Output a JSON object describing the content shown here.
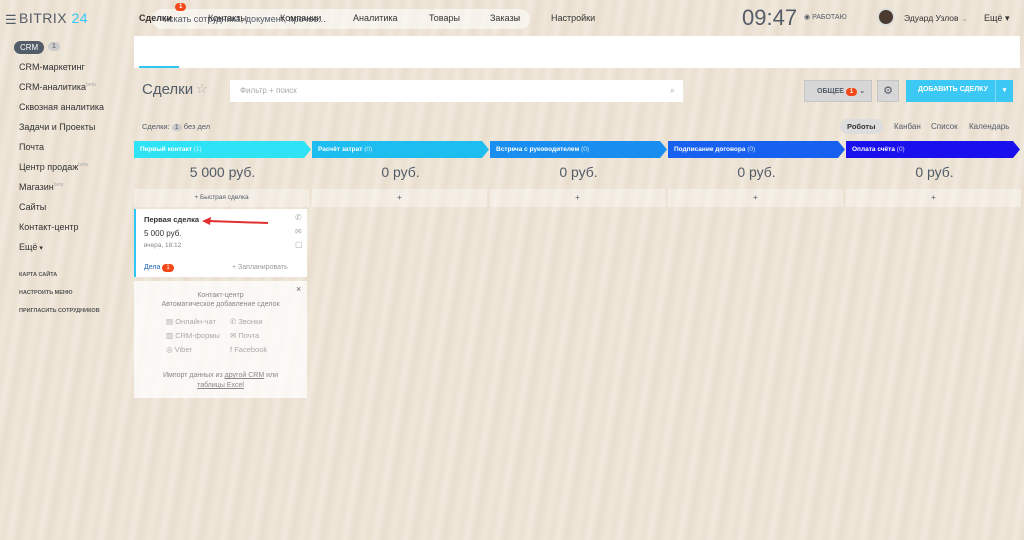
{
  "app": {
    "logo_text": "BITRIX",
    "logo_num": "24",
    "menu_icon": "☰"
  },
  "search": {
    "placeholder": "искать сотрудника, документ, прочее..."
  },
  "clock": {
    "time": "09:47",
    "status": "РАБОТАЮ"
  },
  "user": {
    "name": "Эдуард Узлов"
  },
  "sidebar": {
    "crm": "CRM",
    "crm_count": "1",
    "items": [
      {
        "label": "CRM-маркетинг",
        "sup": ""
      },
      {
        "label": "CRM-аналитика",
        "sup": "beta"
      },
      {
        "label": "Сквозная аналитика",
        "sup": ""
      },
      {
        "label": "Задачи и Проекты",
        "sup": ""
      },
      {
        "label": "Почта",
        "sup": ""
      },
      {
        "label": "Центр продаж",
        "sup": "beta"
      },
      {
        "label": "Магазин",
        "sup": "beta"
      },
      {
        "label": "Сайты",
        "sup": ""
      },
      {
        "label": "Контакт-центр",
        "sup": ""
      },
      {
        "label": "Ещё",
        "sup": ""
      }
    ],
    "small": [
      "КАРТА САЙТА",
      "НАСТРОИТЬ МЕНЮ",
      "ПРИГЛАСИТЬ СОТРУДНИКОВ"
    ]
  },
  "tabs": [
    {
      "label": "Сделки",
      "badge": "1"
    },
    {
      "label": "Контакты"
    },
    {
      "label": "Компании"
    },
    {
      "label": "Аналитика"
    },
    {
      "label": "Товары"
    },
    {
      "label": "Заказы"
    },
    {
      "label": "Настройки"
    }
  ],
  "tabs_more": "Ещё",
  "page": {
    "title": "Сделки",
    "filter_placeholder": "Фильтр + поиск",
    "general": "ОБЩЕЕ",
    "general_badge": "1",
    "add_deal": "ДОБАВИТЬ СДЕЛКУ",
    "deals_label": "Сделки:",
    "deals_count": "1",
    "deals_suffix": "без дел"
  },
  "views": [
    "Роботы",
    "Канбан",
    "Список",
    "Календарь"
  ],
  "stages": [
    {
      "name": "Первый контакт",
      "count": "(1)",
      "sum": "5 000 руб.",
      "color": "#2fe3f6",
      "add": "+ Быстрая сделка"
    },
    {
      "name": "Расчёт затрат",
      "count": "(0)",
      "sum": "0 руб.",
      "color": "#1ebdf0",
      "add": "+"
    },
    {
      "name": "Встреча с руководителем",
      "count": "(0)",
      "sum": "0 руб.",
      "color": "#1a8ef0",
      "add": "+"
    },
    {
      "name": "Подписание договора",
      "count": "(0)",
      "sum": "0 руб.",
      "color": "#1860f0",
      "add": "+"
    },
    {
      "name": "Оплата счёта",
      "count": "(0)",
      "sum": "0 руб.",
      "color": "#1a10ee",
      "add": "+"
    }
  ],
  "card": {
    "title": "Первая сделка",
    "amount": "5 000 руб.",
    "date": "вчера, 18:12",
    "activities": "Дела",
    "activities_badge": "1",
    "plan": "+ Запланировать"
  },
  "promo": {
    "title": "Контакт-центр",
    "subtitle": "Автоматическое добавление сделок",
    "channels": [
      "Онлайн-чат",
      "Звонки",
      "CRM-формы",
      "Почта",
      "Viber",
      "Facebook"
    ],
    "import_1": "Импорт данных из",
    "import_link_1": "другой CRM",
    "import_2": "или",
    "import_link_2": "таблицы Excel",
    "close": "×"
  }
}
